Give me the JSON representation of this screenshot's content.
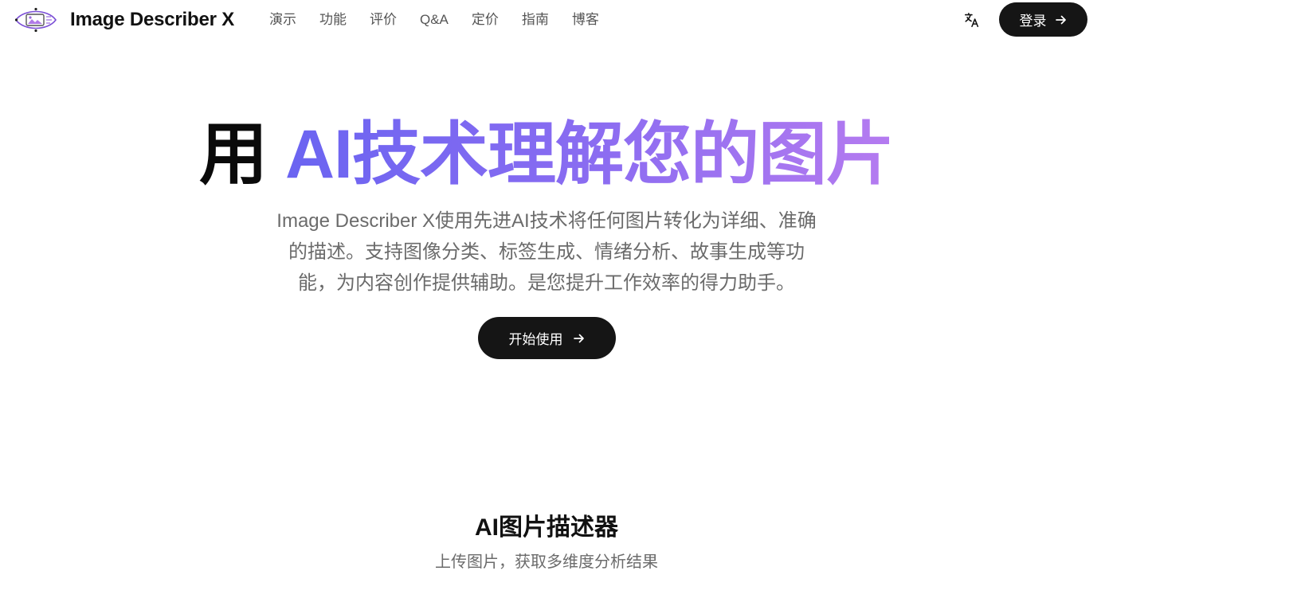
{
  "header": {
    "brand_name": "Image Describer X",
    "nav": [
      {
        "label": "演示"
      },
      {
        "label": "功能"
      },
      {
        "label": "评价"
      },
      {
        "label": "Q&A"
      },
      {
        "label": "定价"
      },
      {
        "label": "指南"
      },
      {
        "label": "博客"
      }
    ],
    "language_icon": "translate-icon",
    "login_label": "登录"
  },
  "hero": {
    "title_plain": "用 ",
    "title_highlight": "AI技术理解您的图片",
    "description": "Image Describer X使用先进AI技术将任何图片转化为详细、准确的描述。支持图像分类、标签生成、情绪分析、故事生成等功能，为内容创作提供辅助。是您提升工作效率的得力助手。",
    "cta_label": "开始使用"
  },
  "section": {
    "title": "AI图片描述器",
    "subtitle": "上传图片，获取多维度分析结果"
  },
  "colors": {
    "gradient_start": "#6a64f1",
    "gradient_end": "#b57bf0",
    "button_bg": "#151515",
    "muted_text": "#6b6b6b"
  }
}
